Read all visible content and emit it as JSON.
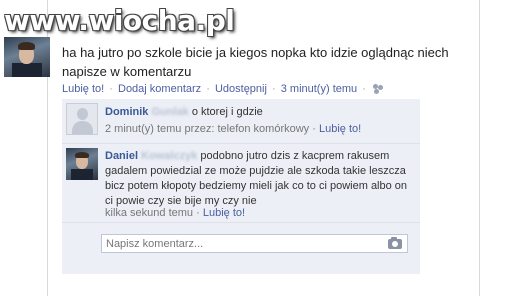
{
  "watermark": "www.wiocha.pl",
  "post": {
    "text": "ha ha jutro po szkole bicie ja kiegos nopka kto idzie oglądnąc niech napisze w komentarzu",
    "actions": {
      "like": "Lubię to!",
      "comment": "Dodaj komentarz",
      "share": "Udostępnij",
      "time": "3 minut(y) temu",
      "separator": "·"
    }
  },
  "comments": [
    {
      "name": "Dominik",
      "surname_obscured": "Gunlak",
      "text": "o ktorej i gdzie",
      "meta": "2 minut(y) temu przez: telefon komórkowy",
      "like": "Lubię to!"
    },
    {
      "name": "Daniel",
      "surname_obscured": "Kowalczyk",
      "text": "podobno jutro dzis z kacprem rakusem gadalem powiedzial ze może pujdzie ale szkoda takie leszcza bicz potem kłopoty bedziemy mieli jak co to ci powiem albo on ci powie czy sie bije my czy nie",
      "meta": "kilka sekund temu",
      "like": "Lubię to!"
    }
  ],
  "comment_box": {
    "placeholder": "Napisz komentarz..."
  },
  "icons": {
    "audience": "people-icon",
    "camera": "camera-icon"
  },
  "colors": {
    "link": "#3b5998",
    "comment_bg": "#eceff5"
  }
}
